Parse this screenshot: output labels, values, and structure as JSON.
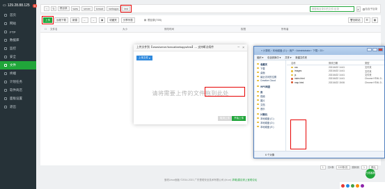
{
  "sidebar": {
    "brand": "129.28.88.125",
    "badge": "0",
    "items": [
      {
        "label": "首页"
      },
      {
        "label": "网站"
      },
      {
        "label": "FTP"
      },
      {
        "label": "数据库"
      },
      {
        "label": "监控"
      },
      {
        "label": "安全"
      },
      {
        "label": "文件"
      },
      {
        "label": "终端"
      },
      {
        "label": "计划任务"
      },
      {
        "label": "软件商店"
      },
      {
        "label": "面板设置"
      },
      {
        "label": "退出"
      }
    ]
  },
  "toolbar1": {
    "crumbs": [
      "根目录",
      "www",
      "server",
      "tomcat",
      "webapps",
      "test"
    ],
    "search_placeholder": "请搜索目录中的文件/目录",
    "include_subdir": "包含子目录"
  },
  "toolbar2": {
    "upload": "上传",
    "remote_download": "远程下载",
    "new": "新建",
    "favorites": "收藏夹",
    "share_list": "分享列表",
    "root_dir_label": "根目录(7GB)",
    "recycle_bin": "回收站"
  },
  "table_headers": {
    "name": "文件名",
    "size": "大小",
    "modified": "修改时间",
    "perm": "权限",
    "owner": "所有者"
  },
  "pagination": {
    "page": "1",
    "total": "共0条",
    "per_page": "100条/页",
    "goto": "跳转到",
    "page_num": "1",
    "confirm": "确认"
  },
  "copyright": "宝塔Linux面板 ©2014-2021 广东堡塔安全技术有限公司 (bt.cn)",
  "copyright_link": "求助|建议请上宝塔论坛",
  "upload_dialog": {
    "title": "上传文件到【/www/server/tomcat/webapps/test】--- 支持断点续传",
    "tab": "上传文件",
    "drop_text": "请将需要上传的文件拖到此处",
    "cancel": "取消上传",
    "start": "开始上传"
  },
  "explorer": {
    "title_path": "« 计算机 › 本地磁盘 (C:) › 用户 › Administrator › 下载 › 23 ›",
    "menu": [
      "组织 ▾",
      "包含到库中 ▾",
      "共享 ▾",
      "新建文件夹"
    ],
    "nav": [
      {
        "label": "收藏夹",
        "group": true
      },
      {
        "label": "下载",
        "group": false
      },
      {
        "label": "桌面",
        "group": false
      },
      {
        "label": "最近访问的位置",
        "group": false
      },
      {
        "label": "Creative Cloud",
        "group": false
      },
      {
        "label": "WPS网盘",
        "group": true
      },
      {
        "label": "库",
        "group": true
      },
      {
        "label": "视频",
        "group": false
      },
      {
        "label": "图片",
        "group": false
      },
      {
        "label": "文档",
        "group": false
      },
      {
        "label": "音乐",
        "group": false
      },
      {
        "label": "计算机",
        "group": true
      },
      {
        "label": "本地磁盘 (C:)",
        "group": false
      },
      {
        "label": "本地磁盘 (D:)",
        "group": false
      },
      {
        "label": "本地磁盘 (E:)",
        "group": false
      }
    ],
    "headers": {
      "name": "名称",
      "date": "修改日期",
      "type": "类型"
    },
    "files": [
      {
        "name": "css",
        "date": "2021/6/22 14:41",
        "type": "文件夹",
        "kind": "folder"
      },
      {
        "name": "images",
        "date": "2021/6/22 14:41",
        "type": "文件夹",
        "kind": "folder"
      },
      {
        "name": "js",
        "date": "2021/6/22 14:41",
        "type": "文件夹",
        "kind": "folder"
      },
      {
        "name": "index.html",
        "date": "2021/6/22 14:41",
        "type": "Chrome HTML D...",
        "kind": "html"
      },
      {
        "name": "map.html",
        "date": "2021/6/22 15:06",
        "type": "Chrome HTML D...",
        "kind": "html"
      }
    ],
    "status": "6 个对象"
  },
  "float_button": "在线客服"
}
